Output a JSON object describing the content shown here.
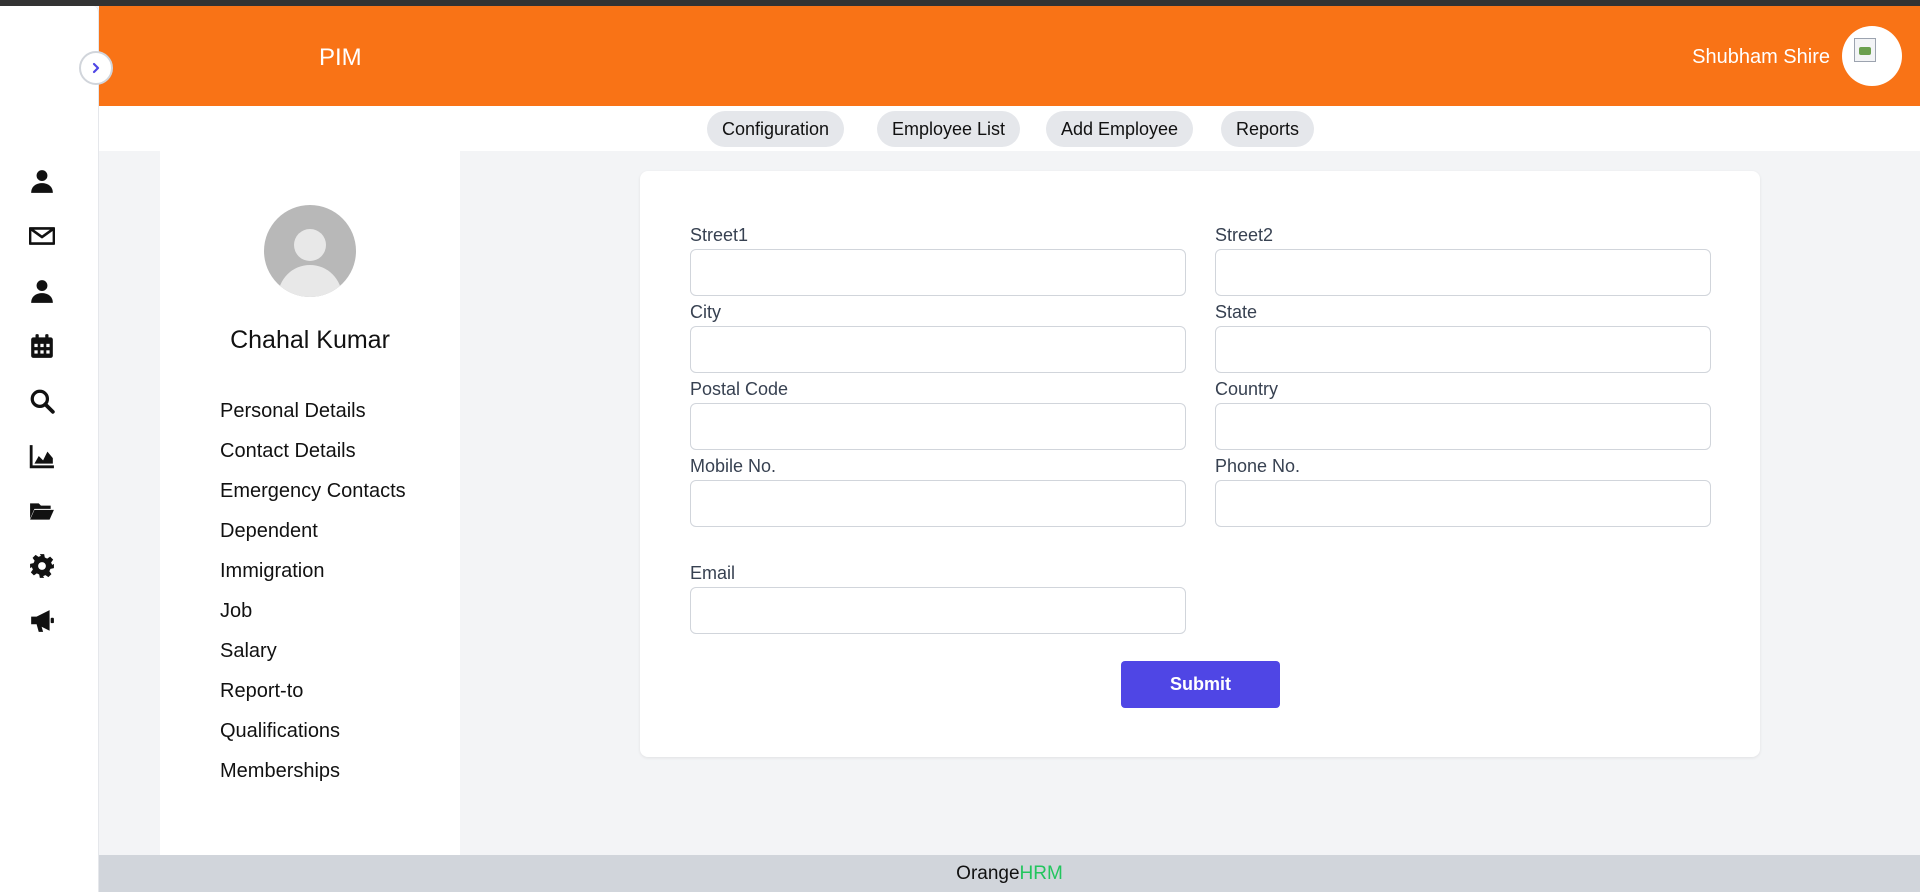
{
  "header": {
    "title": "PIM",
    "user_name": "Shubham Shire"
  },
  "rail": {
    "icons": [
      "user-icon",
      "envelope-icon",
      "user-icon",
      "calendar-icon",
      "search-icon",
      "chart-area-icon",
      "folder-open-icon",
      "gear-icon",
      "megaphone-icon"
    ]
  },
  "subnav": {
    "configuration": "Configuration",
    "employee_list": "Employee List",
    "add_employee": "Add Employee",
    "reports": "Reports"
  },
  "profile": {
    "name": "Chahal Kumar",
    "menu": [
      "Personal Details",
      "Contact Details",
      "Emergency Contacts",
      "Dependent",
      "Immigration",
      "Job",
      "Salary",
      "Report-to",
      "Qualifications",
      "Memberships"
    ]
  },
  "form": {
    "street1": {
      "label": "Street1",
      "value": ""
    },
    "street2": {
      "label": "Street2",
      "value": ""
    },
    "city": {
      "label": "City",
      "value": ""
    },
    "state": {
      "label": "State",
      "value": ""
    },
    "postal_code": {
      "label": "Postal Code",
      "value": ""
    },
    "country": {
      "label": "Country",
      "value": ""
    },
    "mobile": {
      "label": "Mobile No.",
      "value": ""
    },
    "phone": {
      "label": "Phone No.",
      "value": ""
    },
    "email": {
      "label": "Email",
      "value": ""
    },
    "submit_label": "Submit"
  },
  "footer": {
    "brand_main": "Orange",
    "brand_accent": "HRM"
  },
  "colors": {
    "header": "#f97316",
    "submit": "#4f46e5",
    "footer_accent": "#22c55e"
  }
}
